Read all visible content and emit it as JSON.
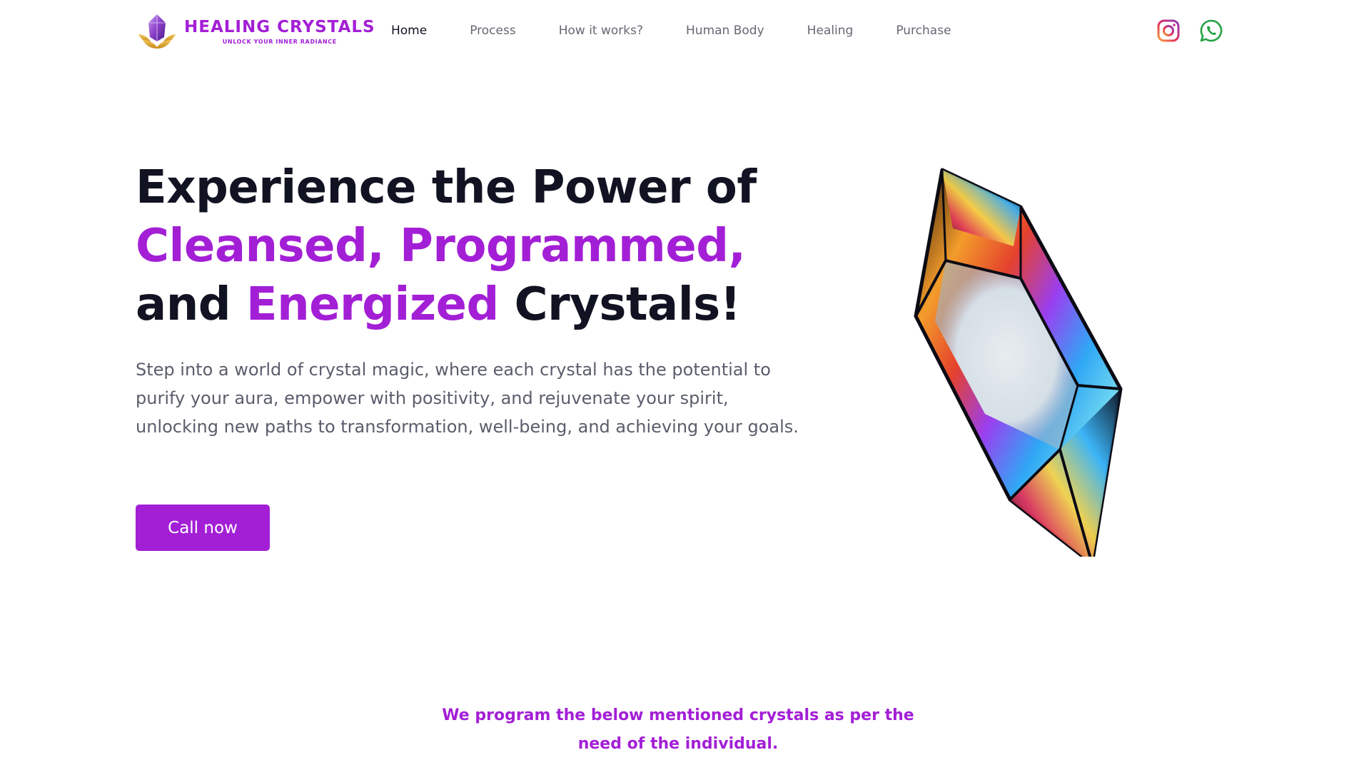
{
  "brand": {
    "title": "HEALING CRYSTALS",
    "tagline": "UNLOCK YOUR INNER RADIANCE",
    "accent_color": "#a31fd6"
  },
  "nav": {
    "items": [
      {
        "label": "Home",
        "active": true
      },
      {
        "label": "Process"
      },
      {
        "label": "How it works?"
      },
      {
        "label": "Human Body"
      },
      {
        "label": "Healing"
      },
      {
        "label": "Purchase"
      }
    ]
  },
  "social": [
    {
      "icon": "instagram-icon",
      "color": "#c13584"
    },
    {
      "icon": "whatsapp-icon",
      "color": "#25a244"
    }
  ],
  "hero": {
    "line1": "Experience the Power of",
    "line2": "Cleansed, Programmed,",
    "line3_a": "and ",
    "line3_b": "Energized",
    "line3_c": " Crystals!",
    "description": "Step into a world of crystal magic, where each crystal has the potential to purify your aura, empower with positivity, and rejuvenate your spirit, unlocking new paths to transformation, well-being, and achieving your goals.",
    "cta_label": "Call now",
    "image_icon": "crystal-illustration"
  },
  "section": {
    "intro_line1": "We program the below mentioned crystals as per the",
    "intro_line2": "need of the individual."
  }
}
